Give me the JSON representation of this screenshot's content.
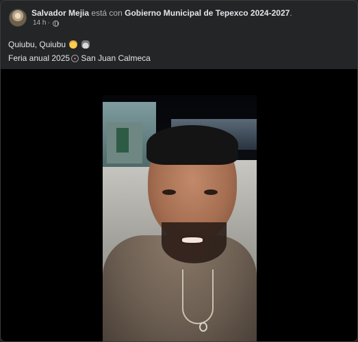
{
  "post": {
    "author": "Salvador Mejia",
    "relation": "está con",
    "tagged": "Gobierno Municipal de Tepexco 2024-2027",
    "trailing_punct": ".",
    "time": "14 h",
    "separator": "·",
    "line1": "Quiubu, Quiubu",
    "line2_prefix": "Feria anual 2025",
    "line2_suffix": "San Juan Calmeca",
    "icons": [
      "cowboy-face-emoji",
      "ghost-emoji",
      "ferris-wheel-emoji",
      "globe-icon"
    ]
  }
}
